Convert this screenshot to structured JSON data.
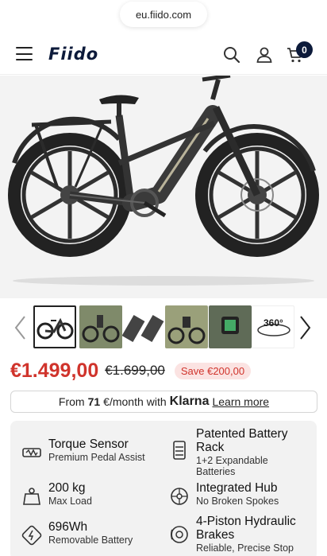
{
  "browser": {
    "url": "eu.fiido.com"
  },
  "header": {
    "logo": "Fiido",
    "cart_count": "0"
  },
  "gallery": {
    "thumbnails": [
      "Side view of e-bike",
      "Rider on trail",
      "Classic vs New battery",
      "Rider with gear",
      "Handlebar display",
      "360° view"
    ],
    "view_360_label": "360°"
  },
  "pricing": {
    "price": "€1.499,00",
    "old_price": "€1.699,00",
    "save": "Save €200,00"
  },
  "klarna": {
    "prefix": "From",
    "amount": "71",
    "suffix": "€/month",
    "with": "with",
    "brand": "Klarna",
    "learn_more": "Learn more"
  },
  "features": [
    {
      "title": "Torque Sensor",
      "sub": "Premium Pedal Assist",
      "icon": "torque-sensor-icon"
    },
    {
      "title": "Patented Battery Rack",
      "sub": "1+2 Expandable Batteries",
      "icon": "battery-rack-icon"
    },
    {
      "title": "200 kg",
      "sub": "Max Load",
      "icon": "weight-icon"
    },
    {
      "title": "Integrated Hub",
      "sub": "No Broken Spokes",
      "icon": "wheel-hub-icon"
    },
    {
      "title": "696Wh",
      "sub": "Removable Battery",
      "icon": "battery-icon"
    },
    {
      "title": "4-Piston Hydraulic Brakes",
      "sub": "Reliable, Precise Stop",
      "icon": "brake-icon"
    }
  ],
  "colors": {
    "accent": "#d0342c",
    "brand": "#0c1a3a"
  }
}
